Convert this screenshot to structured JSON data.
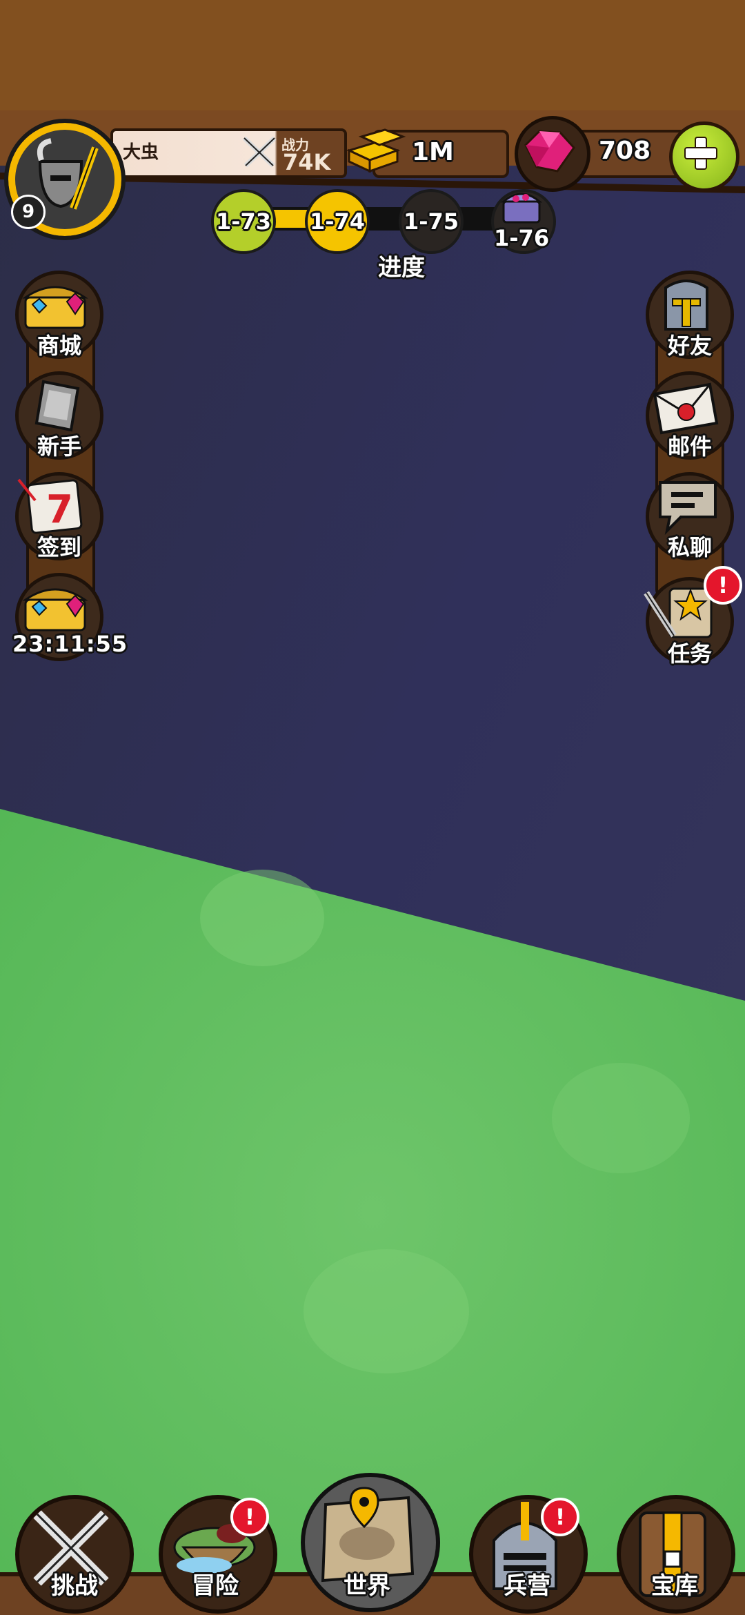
{
  "player": {
    "name": "大虫",
    "level": "9",
    "power_label": "战力",
    "power_value": "74K"
  },
  "resources": {
    "gold": "1M",
    "gems": "708"
  },
  "progress": {
    "label": "进度",
    "stages": [
      {
        "label": "1-73",
        "state": "completed",
        "color": "#b4cf2a"
      },
      {
        "label": "1-74",
        "state": "current",
        "color": "#f5c400"
      },
      {
        "label": "1-75",
        "state": "locked",
        "color": "#2a2522"
      },
      {
        "label": "1-76",
        "state": "reward",
        "color": "#2a2522"
      }
    ]
  },
  "left_menu": {
    "shop": "商城",
    "newbie": "新手",
    "signin": "签到",
    "timer": "23:11:55"
  },
  "right_menu": {
    "friends": "好友",
    "mail": "邮件",
    "chat": "私聊",
    "tasks": "任务"
  },
  "bottom_nav": {
    "challenge": "挑战",
    "adventure": "冒险",
    "world": "世界",
    "barracks": "兵营",
    "treasury": "宝库"
  },
  "alerts": {
    "mark": "!"
  },
  "colors": {
    "wood": "#7a4a22",
    "sky": "#343356",
    "grass": "#5cbf5c",
    "gold": "#f5b800",
    "gem": "#e0207a",
    "plus": "#9dca22",
    "alert": "#e4162c"
  }
}
